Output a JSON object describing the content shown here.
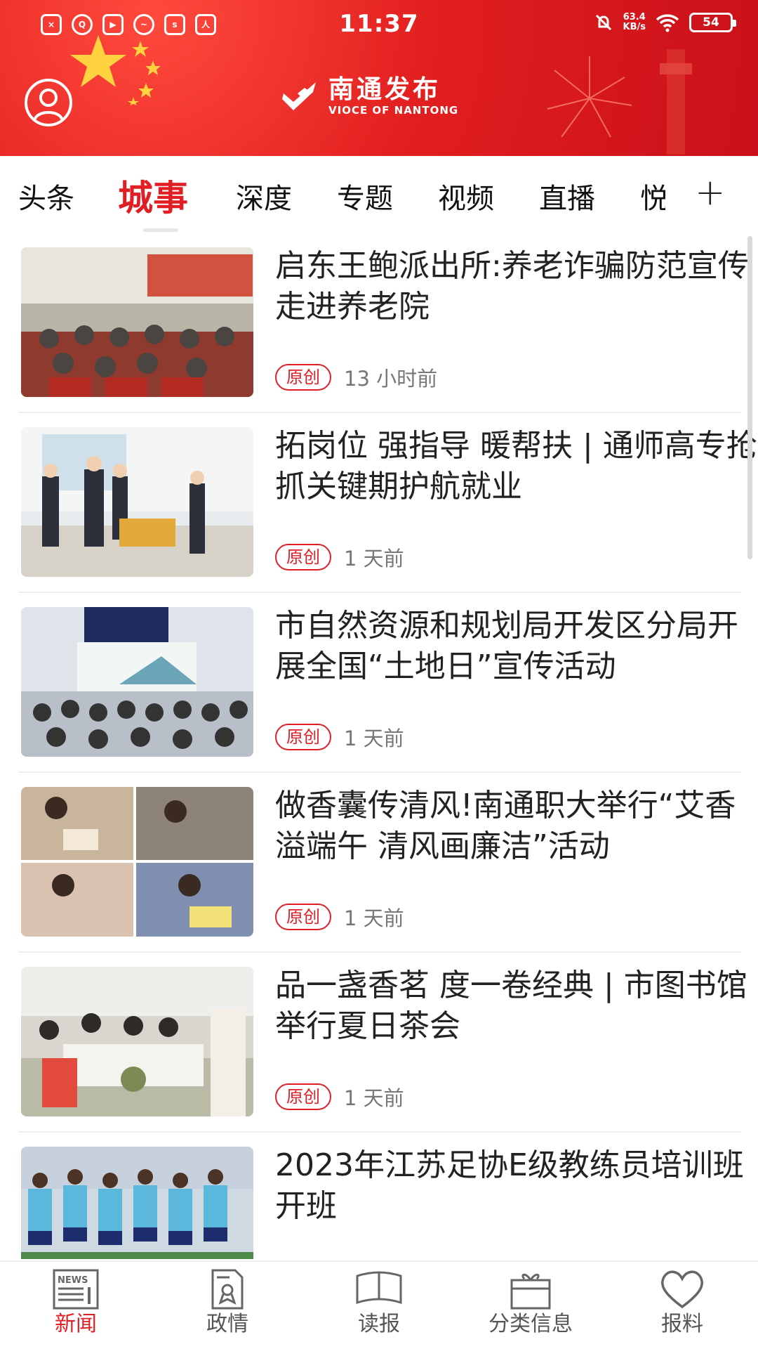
{
  "status_bar": {
    "time": "11:37",
    "net_speed_value": "63.4",
    "net_speed_unit": "KB/s",
    "battery": "54",
    "app_icons": [
      "app-x-icon",
      "qq-icon",
      "video-icon",
      "weibo-icon",
      "sina-icon",
      "peoples-daily-icon"
    ]
  },
  "brand": {
    "name_cn": "南通发布",
    "name_en": "VIOCE OF NANTONG"
  },
  "tabs": [
    {
      "label": "头条"
    },
    {
      "label": "城事",
      "active": true
    },
    {
      "label": "深度"
    },
    {
      "label": "专题"
    },
    {
      "label": "视频"
    },
    {
      "label": "直播"
    },
    {
      "label": "悦"
    }
  ],
  "tab_add_label": "+",
  "news": [
    {
      "title": "启东王鲍派出所:养老诈骗防范宣传走进养老院",
      "tag": "原创",
      "time": "13 小时前"
    },
    {
      "title": "拓岗位 强指导 暖帮扶 | 通师高专抢抓关键期护航就业",
      "tag": "原创",
      "time": "1 天前"
    },
    {
      "title": "市自然资源和规划局开发区分局开展全国“土地日”宣传活动",
      "tag": "原创",
      "time": "1 天前"
    },
    {
      "title": "做香囊传清风!南通职大举行“艾香溢端午 清风画廉洁”活动",
      "tag": "原创",
      "time": "1 天前"
    },
    {
      "title": "品一盏香茗 度一卷经典 | 市图书馆举行夏日茶会",
      "tag": "原创",
      "time": "1 天前"
    },
    {
      "title": "2023年江苏足协E级教练员培训班开班",
      "tag": "",
      "time": ""
    }
  ],
  "bottom_nav": [
    {
      "label": "新闻",
      "icon": "newspaper-icon",
      "active": true
    },
    {
      "label": "政情",
      "icon": "document-award-icon"
    },
    {
      "label": "读报",
      "icon": "open-paper-icon"
    },
    {
      "label": "分类信息",
      "icon": "gift-box-icon"
    },
    {
      "label": "报料",
      "icon": "heart-icon"
    }
  ],
  "colors": {
    "brand_red": "#e01e24",
    "header_red": "#e21f1f"
  }
}
